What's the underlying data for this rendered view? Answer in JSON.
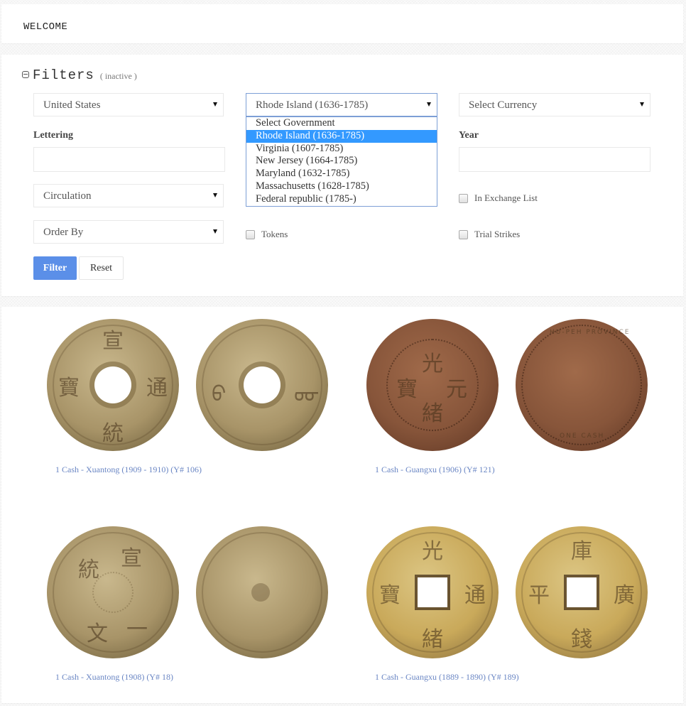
{
  "header": {
    "welcome": "WELCOME"
  },
  "filters": {
    "title": "Filters",
    "status": "( inactive )",
    "country_select": {
      "value": "United States"
    },
    "government_select": {
      "value": "Rhode Island (1636-1785)",
      "options": [
        "Select Government",
        "Rhode Island (1636-1785)",
        "Virginia (1607-1785)",
        "New Jersey (1664-1785)",
        "Maryland (1632-1785)",
        "Massachusetts (1628-1785)",
        "Federal republic (1785-)"
      ],
      "selected_index": 1
    },
    "currency_select": {
      "value": "Select Currency"
    },
    "lettering_label": "Lettering",
    "lettering_value": "",
    "year_label": "Year",
    "year_value": "",
    "circulation_select": {
      "value": "Circulation"
    },
    "order_select": {
      "value": "Order By"
    },
    "checkboxes": {
      "exchange": {
        "label": "In Exchange List",
        "checked": false
      },
      "tokens": {
        "label": "Tokens",
        "checked": false
      },
      "trial": {
        "label": "Trial Strikes",
        "checked": false
      }
    },
    "filter_button": "Filter",
    "reset_button": "Reset"
  },
  "results": [
    {
      "title": "1 Cash - Xuantong (1909 - 1910) (Y# 106)",
      "obverse_chars": [
        "宣",
        "通",
        "統",
        "寶"
      ],
      "reverse_chars": [
        "ᠪ",
        "ᡂ"
      ]
    },
    {
      "title": "1 Cash - Guangxu (1906) (Y# 121)",
      "obverse_chars": [
        "光",
        "元",
        "緒",
        "寶"
      ],
      "reverse_chars": [
        "HU-PEH PROVINCE",
        "ONE CASH"
      ]
    },
    {
      "title": "1 Cash - Xuantong (1908) (Y# 18)",
      "obverse_chars": [
        "宣",
        "一",
        "文",
        "統"
      ],
      "reverse_chars": []
    },
    {
      "title": "1 Cash - Guangxu (1889 - 1890) (Y# 189)",
      "obverse_chars": [
        "光",
        "通",
        "緒",
        "寶"
      ],
      "reverse_chars": [
        "庫",
        "廣",
        "錢",
        "平"
      ]
    }
  ]
}
